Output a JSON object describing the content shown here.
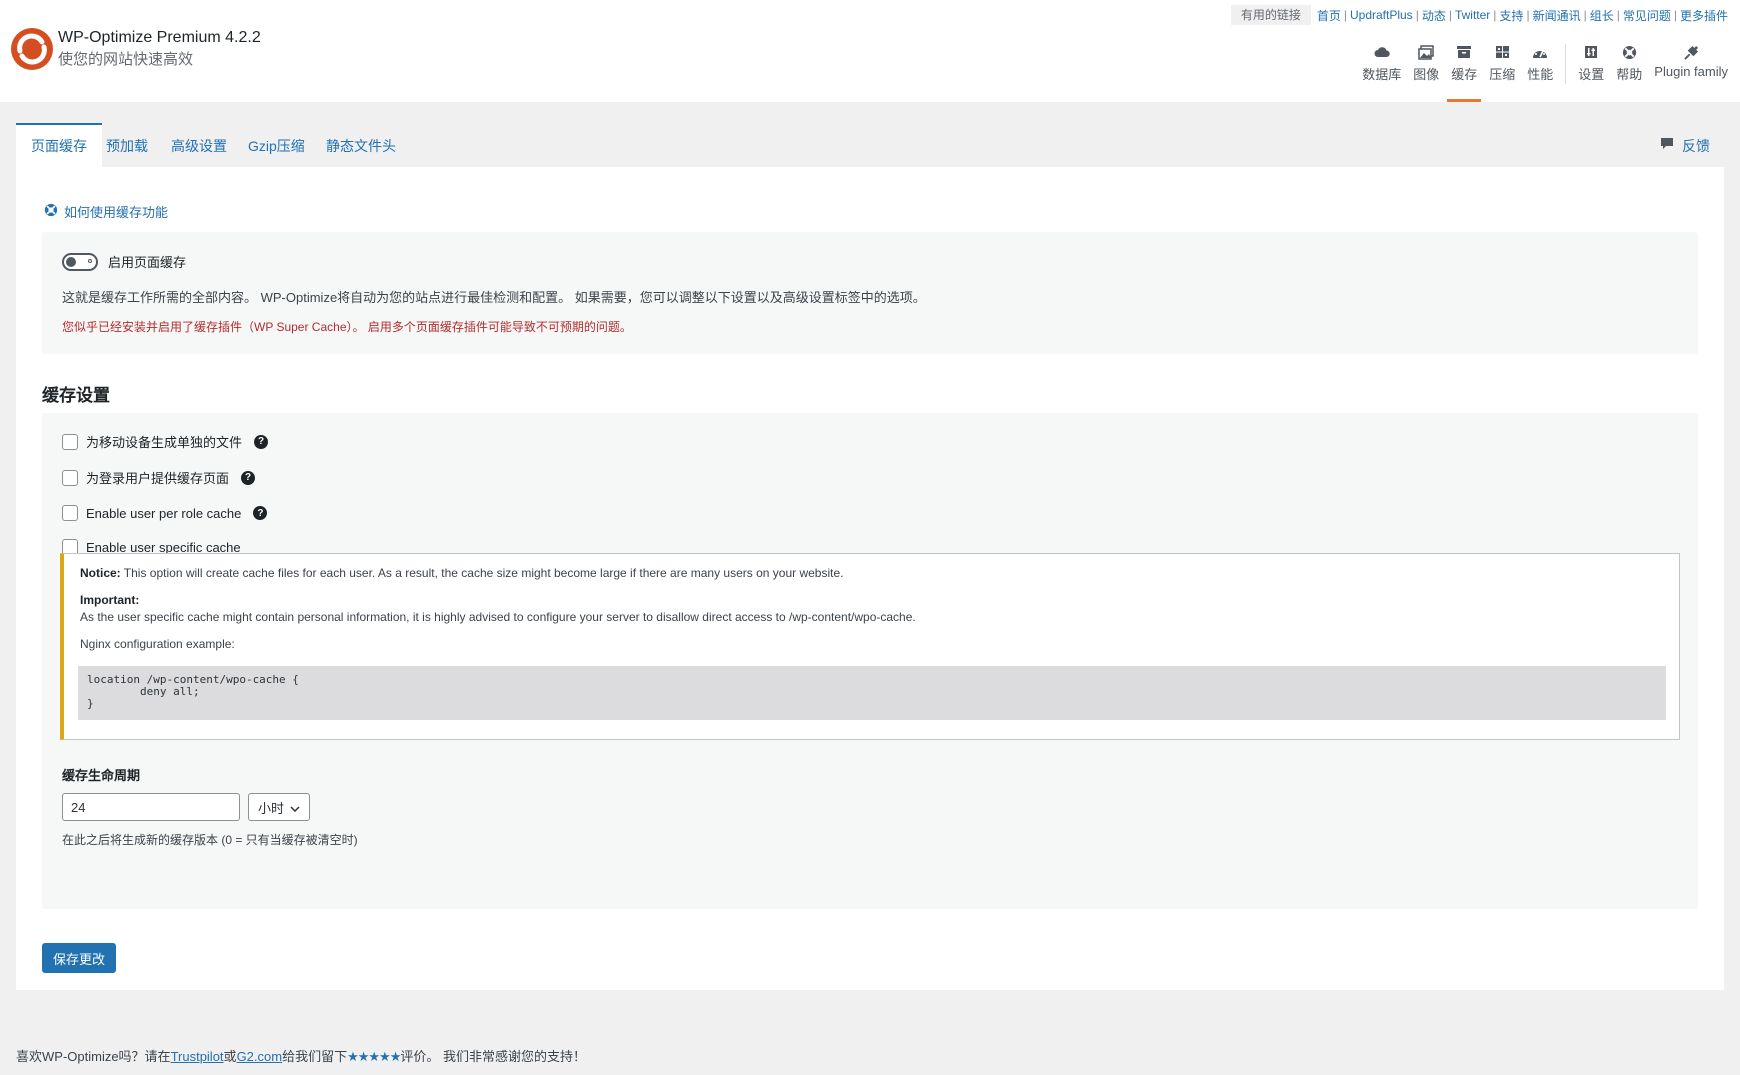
{
  "brand": {
    "title": "WP-Optimize Premium 4.2.2",
    "subtitle": "使您的网站快速高效",
    "colors": {
      "logo": "#d54e21",
      "accent": "#e47b31"
    }
  },
  "toplinks": {
    "label": "有用的链接",
    "items": [
      "首页",
      "UpdraftPlus",
      "动态",
      "Twitter",
      "支持",
      "新闻通讯",
      "组长",
      "常见问题",
      "更多插件"
    ]
  },
  "topnav": {
    "items": [
      {
        "label": "数据库",
        "icon": "cloud-icon"
      },
      {
        "label": "图像",
        "icon": "images-icon"
      },
      {
        "label": "缓存",
        "icon": "archive-icon",
        "active": true
      },
      {
        "label": "压缩",
        "icon": "grid-icon"
      },
      {
        "label": "性能",
        "icon": "dashboard-icon"
      },
      {
        "label": "设置",
        "icon": "settings-icon"
      },
      {
        "label": "帮助",
        "icon": "lifebuoy-icon"
      },
      {
        "label": "Plugin family",
        "icon": "plugin-icon"
      }
    ]
  },
  "tabs": [
    "页面缓存",
    "预加载",
    "高级设置",
    "Gzip压缩",
    "静态文件头"
  ],
  "feedback": "反馈",
  "howto": "如何使用缓存功能",
  "cache_enable": {
    "label": "启用页面缓存",
    "enabled": false,
    "description": "这就是缓存工作所需的全部内容。 WP-Optimize将自动为您的站点进行最佳检测和配置。 如果需要，您可以调整以下设置以及高级设置标签中的选项。",
    "warning": "您似乎已经安装并启用了缓存插件（WP Super Cache）。 启用多个页面缓存插件可能导致不可预期的问题。"
  },
  "cache_settings": {
    "title": "缓存设置",
    "options": [
      {
        "label": "为移动设备生成单独的文件",
        "checked": false,
        "help": true
      },
      {
        "label": "为登录用户提供缓存页面",
        "checked": false,
        "help": true
      },
      {
        "label": "Enable user per role cache",
        "checked": false,
        "help": true
      },
      {
        "label": "Enable user specific cache",
        "checked": false,
        "help": false
      }
    ],
    "notice": {
      "notice_label": "Notice:",
      "notice_text": " This option will create cache files for each user. As a result, the cache size might become large if there are many users on your website.",
      "important_label": "Important:",
      "important_text": "As the user specific cache might contain personal information, it is highly advised to configure your server to disallow direct access to /wp-content/wpo-cache.",
      "nginx_label": "Nginx configuration example:",
      "code": "location /wp-content/wpo-cache {\n        deny all;\n}"
    },
    "lifespan": {
      "label": "缓存生命周期",
      "value": "24",
      "unit": "小时",
      "description": "在此之后将生成新的缓存版本 (0 = 只有当缓存被清空时)"
    }
  },
  "save_button": "保存更改",
  "footer": {
    "pre": "喜欢WP-Optimize吗？请在",
    "link1": "Trustpilot",
    "mid": "或",
    "link2": "G2.com",
    "post1": "给我们留下",
    "stars": "★★★★★",
    "post2": "评价。 我们非常感谢您的支持！"
  }
}
